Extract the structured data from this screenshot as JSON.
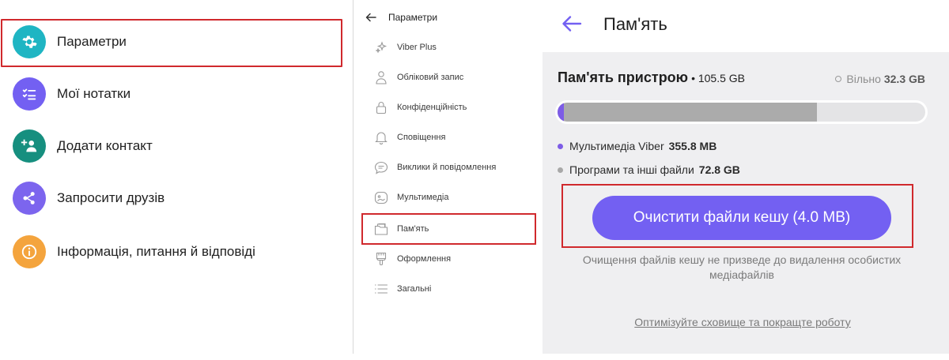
{
  "left_menu": {
    "items": [
      {
        "label": "Параметри",
        "icon": "gear-icon",
        "color": "#1fb5c3"
      },
      {
        "label": "Мої нотатки",
        "icon": "notes-checklist-icon",
        "color": "#7360f2"
      },
      {
        "label": "Додати контакт",
        "icon": "add-contact-icon",
        "color": "#168f7f"
      },
      {
        "label": "Запросити друзів",
        "icon": "share-icon",
        "color": "#7c65ee"
      },
      {
        "label": "Інформація, питання й відповіді",
        "icon": "info-icon",
        "color": "#f4a43d"
      }
    ]
  },
  "settings_menu": {
    "title": "Параметри",
    "items": [
      {
        "label": "Viber Plus",
        "icon": "sparkle-icon"
      },
      {
        "label": "Обліковий запис",
        "icon": "account-icon"
      },
      {
        "label": "Конфіденційність",
        "icon": "lock-icon"
      },
      {
        "label": "Сповіщення",
        "icon": "bell-icon"
      },
      {
        "label": "Виклики й повідомлення",
        "icon": "chat-bubble-icon"
      },
      {
        "label": "Мультимедіа",
        "icon": "media-icon"
      },
      {
        "label": "Пам'ять",
        "icon": "storage-folder-icon"
      },
      {
        "label": "Оформлення",
        "icon": "paint-brush-icon"
      },
      {
        "label": "Загальні",
        "icon": "list-icon"
      }
    ]
  },
  "storage": {
    "title": "Пам'ять",
    "device_label": "Пам'ять пристрою",
    "device_size": "• 105.5 GB",
    "free_label": "Вільно",
    "free_value": "32.3 GB",
    "usage": {
      "viber_fraction": 0.015,
      "other_fraction": 0.706
    },
    "legend": [
      {
        "label": "Мультимедіа Viber",
        "value": "355.8 MB",
        "color": "#7d5ce6"
      },
      {
        "label": "Програми та інші файли",
        "value": "72.8 GB",
        "color": "#a8a8a8"
      }
    ],
    "clear_button": "Очистити файли кешу (4.0 MB)",
    "clear_note": "Очищення файлів кешу не призведе до видалення особистих медіафайлів",
    "optimize_link": "Оптимізуйте сховище та покращте роботу"
  },
  "colors": {
    "accent": "#7360f2",
    "highlight": "#d0292d"
  }
}
